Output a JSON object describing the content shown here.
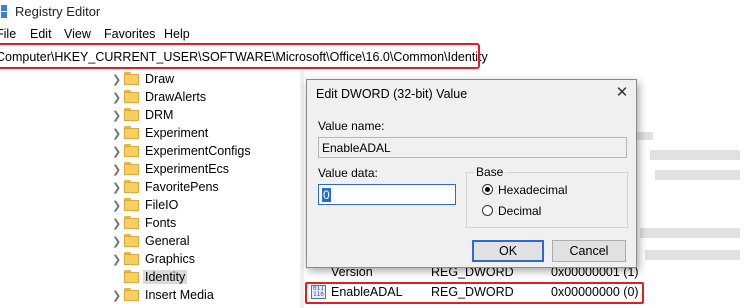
{
  "window": {
    "title": "Registry Editor"
  },
  "menu": [
    "File",
    "Edit",
    "View",
    "Favorites",
    "Help"
  ],
  "address": {
    "path": "Computer\\HKEY_CURRENT_USER\\SOFTWARE\\Microsoft\\Office\\16.0\\Common\\Identity"
  },
  "tree": {
    "items": [
      {
        "label": "Draw"
      },
      {
        "label": "DrawAlerts"
      },
      {
        "label": "DRM"
      },
      {
        "label": "Experiment"
      },
      {
        "label": "ExperimentConfigs"
      },
      {
        "label": "ExperimentEcs"
      },
      {
        "label": "FavoritePens"
      },
      {
        "label": "FileIO"
      },
      {
        "label": "Fonts"
      },
      {
        "label": "General"
      },
      {
        "label": "Graphics"
      },
      {
        "label": "Identity",
        "selected": true
      },
      {
        "label": "Insert Media"
      }
    ]
  },
  "values": {
    "rows": [
      {
        "name": "Version",
        "type": "REG_DWORD",
        "data": "0x00000001 (1)"
      },
      {
        "name": "EnableADAL",
        "type": "REG_DWORD",
        "data": "0x00000000 (0)",
        "highlighted": true
      }
    ]
  },
  "dialog": {
    "title": "Edit DWORD (32-bit) Value",
    "value_name_label": "Value name:",
    "value_name": "EnableADAL",
    "value_data_label": "Value data:",
    "value_data": "0",
    "base_label": "Base",
    "base_options": [
      {
        "label": "Hexadecimal",
        "checked": true
      },
      {
        "label": "Decimal",
        "checked": false
      }
    ],
    "ok_label": "OK",
    "cancel_label": "Cancel",
    "close_glyph": "✕"
  },
  "colors": {
    "highlight_red": "#e02020",
    "accent_blue": "#2a6ad6",
    "folder_yellow": "#f7cf5f"
  }
}
